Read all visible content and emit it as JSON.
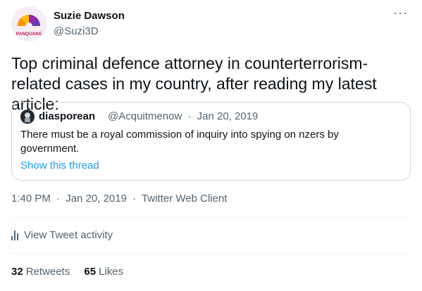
{
  "author": {
    "display_name": "Suzie Dawson",
    "handle": "@Suzi3D",
    "avatar_text": "PANQUAKE",
    "avatar_color": "#c2185b"
  },
  "more_label": "···",
  "tweet": {
    "text": "Top criminal defence attorney in counterterrorism-related cases in my country, after reading my latest article:"
  },
  "quoted": {
    "name": "diasporean",
    "handle": "@Acquitmenow",
    "separator": "·",
    "date": "Jan 20, 2019",
    "text": "There must be a royal commission of inquiry into spying on nzers by government.",
    "show_thread": "Show this thread"
  },
  "meta": {
    "time": "1:40 PM",
    "sep1": "·",
    "date": "Jan 20, 2019",
    "sep2": "·",
    "client": "Twitter Web Client"
  },
  "activity": {
    "label": "View Tweet activity"
  },
  "stats": {
    "retweets_count": "32",
    "retweets_label": "Retweets",
    "likes_count": "65",
    "likes_label": "Likes"
  },
  "colors": {
    "text": "#0f1419",
    "secondary": "#536471",
    "link": "#1d9bf0",
    "border": "#cfd9de"
  }
}
